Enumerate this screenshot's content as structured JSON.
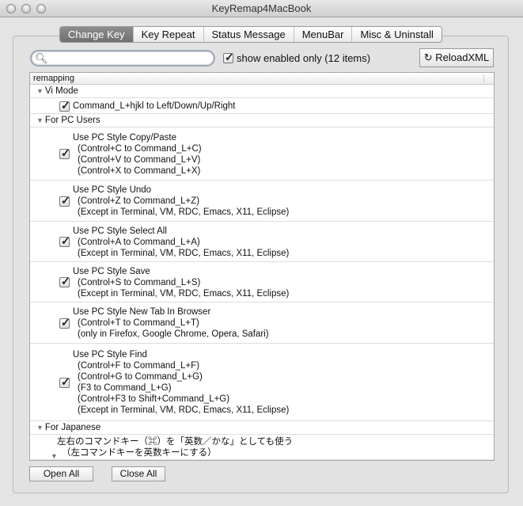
{
  "window": {
    "title": "KeyRemap4MacBook"
  },
  "tabs": [
    {
      "label": "Change Key",
      "active": true
    },
    {
      "label": "Key Repeat"
    },
    {
      "label": "Status Message"
    },
    {
      "label": "MenuBar"
    },
    {
      "label": "Misc & Uninstall"
    }
  ],
  "toolbar": {
    "search_value": "",
    "show_enabled_label": "show enabled only (12 items)",
    "show_enabled_checked": true,
    "reload_label": "ReloadXML",
    "reload_icon": "↻"
  },
  "outline": {
    "header": "remapping",
    "groups": [
      {
        "title": "Vi Mode",
        "items": [
          {
            "lines": [
              "Command_L+hjkl to Left/Down/Up/Right"
            ],
            "checked": true
          }
        ]
      },
      {
        "title": "For PC Users",
        "items": [
          {
            "lines": [
              "Use PC Style Copy/Paste",
              "(Control+C to Command_L+C)",
              "(Control+V to Command_L+V)",
              "(Control+X to Command_L+X)"
            ],
            "checked": true
          },
          {
            "lines": [
              "Use PC Style Undo",
              "(Control+Z to Command_L+Z)",
              "(Except in Terminal, VM, RDC, Emacs, X11, Eclipse)"
            ],
            "checked": true
          },
          {
            "lines": [
              "Use PC Style Select All",
              "(Control+A to Command_L+A)",
              "(Except in Terminal, VM, RDC, Emacs, X11, Eclipse)"
            ],
            "checked": true
          },
          {
            "lines": [
              "Use PC Style Save",
              "(Control+S to Command_L+S)",
              "(Except in Terminal, VM, RDC, Emacs, X11, Eclipse)"
            ],
            "checked": true
          },
          {
            "lines": [
              "Use PC Style New Tab In Browser",
              "(Control+T to Command_L+T)",
              "(only in Firefox, Google Chrome, Opera, Safari)"
            ],
            "checked": true
          },
          {
            "lines": [
              "Use PC Style Find",
              "(Control+F to Command_L+F)",
              "(Control+G to Command_L+G)",
              "(F3 to Command_L+G)",
              "(Control+F3 to Shift+Command_L+G)",
              "(Except in Terminal, VM, RDC, Emacs, X11, Eclipse)"
            ],
            "checked": true
          }
        ]
      },
      {
        "title": "For Japanese",
        "items": [
          {
            "lines": [
              "左右のコマンドキー（⌘）を「英数／かな」としても使う",
              "（左コマンドキーを英数キーにする）"
            ],
            "expandable": true
          }
        ]
      }
    ]
  },
  "buttons": {
    "open_all": "Open All",
    "close_all": "Close All"
  }
}
